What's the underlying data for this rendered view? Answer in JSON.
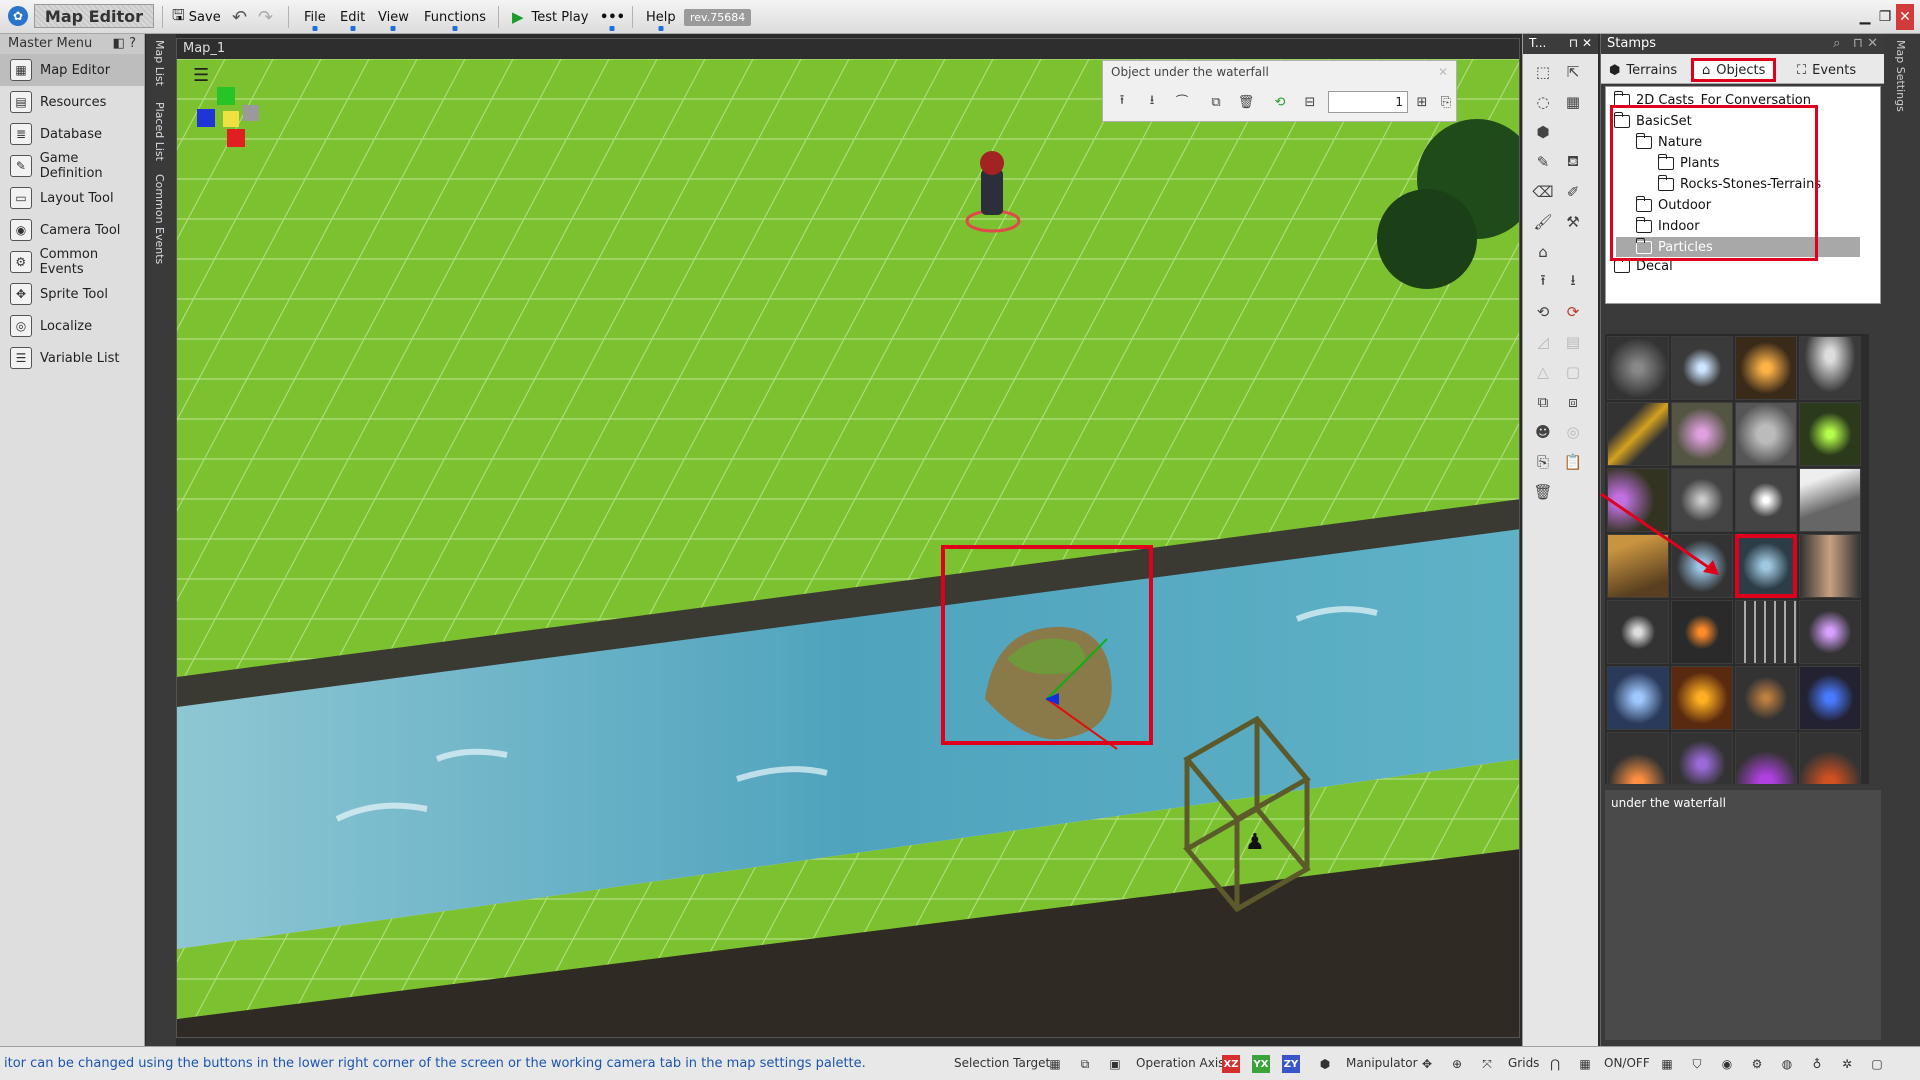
{
  "app": {
    "title": "Map Editor",
    "toolbar": {
      "save_label": "Save",
      "menus": [
        "File",
        "Edit",
        "View",
        "Functions"
      ],
      "test_play_label": "Test Play",
      "more_label": "•••",
      "help_label": "Help",
      "revision": "rev.75684"
    }
  },
  "master_menu": {
    "title": "Master Menu",
    "items": [
      {
        "label": "Map Editor",
        "icon": "map-editor-icon",
        "active": true
      },
      {
        "label": "Resources",
        "icon": "resources-icon"
      },
      {
        "label": "Database",
        "icon": "database-icon"
      },
      {
        "label": "Game Definition",
        "icon": "game-definition-icon"
      },
      {
        "label": "Layout Tool",
        "icon": "layout-tool-icon"
      },
      {
        "label": "Camera Tool",
        "icon": "camera-tool-icon"
      },
      {
        "label": "Common Events",
        "icon": "common-events-icon"
      },
      {
        "label": "Sprite Tool",
        "icon": "sprite-tool-icon"
      },
      {
        "label": "Localize",
        "icon": "localize-icon"
      },
      {
        "label": "Variable List",
        "icon": "variable-list-icon"
      }
    ]
  },
  "side_tabs": [
    "Map List",
    "Placed List",
    "Common Events"
  ],
  "viewport": {
    "tab_label": "Map_1"
  },
  "object_panel": {
    "title": "Object under the waterfall",
    "value": "1"
  },
  "tools_panel": {
    "title": "T..."
  },
  "stamps": {
    "title": "Stamps",
    "tabs": [
      "Terrains",
      "Objects",
      "Events"
    ],
    "active_tab": "Objects",
    "tree": [
      {
        "label": "2D Casts_For Conversation",
        "level": 0
      },
      {
        "label": "BasicSet",
        "level": 0,
        "open": true
      },
      {
        "label": "Nature",
        "level": 1
      },
      {
        "label": "Plants",
        "level": 2
      },
      {
        "label": "Rocks-Stones-Terrains",
        "level": 2
      },
      {
        "label": "Outdoor",
        "level": 1
      },
      {
        "label": "Indoor",
        "level": 1
      },
      {
        "label": "Particles",
        "level": 1,
        "selected": true
      },
      {
        "label": "Decal",
        "level": 0
      }
    ],
    "description": "under the waterfall"
  },
  "map_settings_label": "Map Settings",
  "status_bar": {
    "message": "itor can be changed using the buttons in the lower right corner of the screen or the working camera tab in the map settings palette.",
    "selection_target": "Selection Target",
    "operation_axis": "Operation Axis",
    "axes": [
      "XZ",
      "YX",
      "ZY"
    ],
    "manipulator": "Manipulator",
    "grids": "Grids",
    "onoff": "ON/OFF"
  },
  "colors": {
    "highlight": "#e0001b",
    "grass": "#7cc230",
    "water": "#4fa3bd",
    "link_text": "#1a55b0"
  }
}
